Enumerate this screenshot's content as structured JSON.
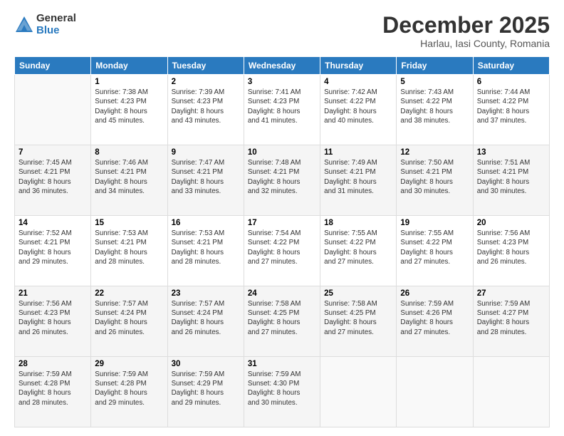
{
  "logo": {
    "general": "General",
    "blue": "Blue"
  },
  "title": "December 2025",
  "location": "Harlau, Iasi County, Romania",
  "days_header": [
    "Sunday",
    "Monday",
    "Tuesday",
    "Wednesday",
    "Thursday",
    "Friday",
    "Saturday"
  ],
  "weeks": [
    [
      {
        "day": "",
        "info": ""
      },
      {
        "day": "1",
        "info": "Sunrise: 7:38 AM\nSunset: 4:23 PM\nDaylight: 8 hours\nand 45 minutes."
      },
      {
        "day": "2",
        "info": "Sunrise: 7:39 AM\nSunset: 4:23 PM\nDaylight: 8 hours\nand 43 minutes."
      },
      {
        "day": "3",
        "info": "Sunrise: 7:41 AM\nSunset: 4:23 PM\nDaylight: 8 hours\nand 41 minutes."
      },
      {
        "day": "4",
        "info": "Sunrise: 7:42 AM\nSunset: 4:22 PM\nDaylight: 8 hours\nand 40 minutes."
      },
      {
        "day": "5",
        "info": "Sunrise: 7:43 AM\nSunset: 4:22 PM\nDaylight: 8 hours\nand 38 minutes."
      },
      {
        "day": "6",
        "info": "Sunrise: 7:44 AM\nSunset: 4:22 PM\nDaylight: 8 hours\nand 37 minutes."
      }
    ],
    [
      {
        "day": "7",
        "info": "Sunrise: 7:45 AM\nSunset: 4:21 PM\nDaylight: 8 hours\nand 36 minutes."
      },
      {
        "day": "8",
        "info": "Sunrise: 7:46 AM\nSunset: 4:21 PM\nDaylight: 8 hours\nand 34 minutes."
      },
      {
        "day": "9",
        "info": "Sunrise: 7:47 AM\nSunset: 4:21 PM\nDaylight: 8 hours\nand 33 minutes."
      },
      {
        "day": "10",
        "info": "Sunrise: 7:48 AM\nSunset: 4:21 PM\nDaylight: 8 hours\nand 32 minutes."
      },
      {
        "day": "11",
        "info": "Sunrise: 7:49 AM\nSunset: 4:21 PM\nDaylight: 8 hours\nand 31 minutes."
      },
      {
        "day": "12",
        "info": "Sunrise: 7:50 AM\nSunset: 4:21 PM\nDaylight: 8 hours\nand 30 minutes."
      },
      {
        "day": "13",
        "info": "Sunrise: 7:51 AM\nSunset: 4:21 PM\nDaylight: 8 hours\nand 30 minutes."
      }
    ],
    [
      {
        "day": "14",
        "info": "Sunrise: 7:52 AM\nSunset: 4:21 PM\nDaylight: 8 hours\nand 29 minutes."
      },
      {
        "day": "15",
        "info": "Sunrise: 7:53 AM\nSunset: 4:21 PM\nDaylight: 8 hours\nand 28 minutes."
      },
      {
        "day": "16",
        "info": "Sunrise: 7:53 AM\nSunset: 4:21 PM\nDaylight: 8 hours\nand 28 minutes."
      },
      {
        "day": "17",
        "info": "Sunrise: 7:54 AM\nSunset: 4:22 PM\nDaylight: 8 hours\nand 27 minutes."
      },
      {
        "day": "18",
        "info": "Sunrise: 7:55 AM\nSunset: 4:22 PM\nDaylight: 8 hours\nand 27 minutes."
      },
      {
        "day": "19",
        "info": "Sunrise: 7:55 AM\nSunset: 4:22 PM\nDaylight: 8 hours\nand 27 minutes."
      },
      {
        "day": "20",
        "info": "Sunrise: 7:56 AM\nSunset: 4:23 PM\nDaylight: 8 hours\nand 26 minutes."
      }
    ],
    [
      {
        "day": "21",
        "info": "Sunrise: 7:56 AM\nSunset: 4:23 PM\nDaylight: 8 hours\nand 26 minutes."
      },
      {
        "day": "22",
        "info": "Sunrise: 7:57 AM\nSunset: 4:24 PM\nDaylight: 8 hours\nand 26 minutes."
      },
      {
        "day": "23",
        "info": "Sunrise: 7:57 AM\nSunset: 4:24 PM\nDaylight: 8 hours\nand 26 minutes."
      },
      {
        "day": "24",
        "info": "Sunrise: 7:58 AM\nSunset: 4:25 PM\nDaylight: 8 hours\nand 27 minutes."
      },
      {
        "day": "25",
        "info": "Sunrise: 7:58 AM\nSunset: 4:25 PM\nDaylight: 8 hours\nand 27 minutes."
      },
      {
        "day": "26",
        "info": "Sunrise: 7:59 AM\nSunset: 4:26 PM\nDaylight: 8 hours\nand 27 minutes."
      },
      {
        "day": "27",
        "info": "Sunrise: 7:59 AM\nSunset: 4:27 PM\nDaylight: 8 hours\nand 28 minutes."
      }
    ],
    [
      {
        "day": "28",
        "info": "Sunrise: 7:59 AM\nSunset: 4:28 PM\nDaylight: 8 hours\nand 28 minutes."
      },
      {
        "day": "29",
        "info": "Sunrise: 7:59 AM\nSunset: 4:28 PM\nDaylight: 8 hours\nand 29 minutes."
      },
      {
        "day": "30",
        "info": "Sunrise: 7:59 AM\nSunset: 4:29 PM\nDaylight: 8 hours\nand 29 minutes."
      },
      {
        "day": "31",
        "info": "Sunrise: 7:59 AM\nSunset: 4:30 PM\nDaylight: 8 hours\nand 30 minutes."
      },
      {
        "day": "",
        "info": ""
      },
      {
        "day": "",
        "info": ""
      },
      {
        "day": "",
        "info": ""
      }
    ]
  ]
}
